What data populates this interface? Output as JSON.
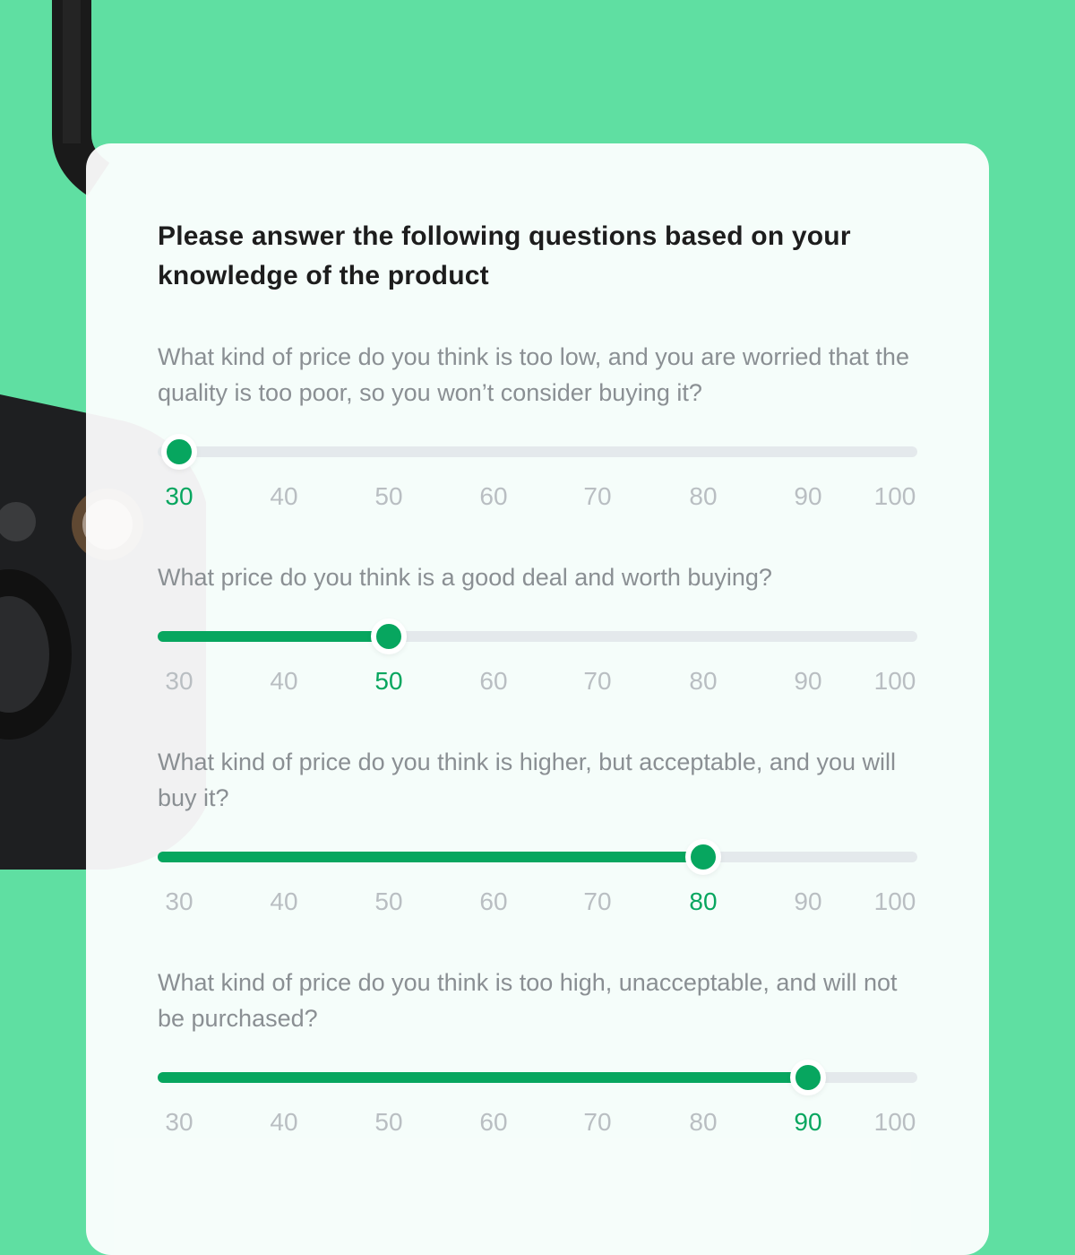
{
  "heading": "Please answer the following questions based on your knowledge of the product",
  "scale": [
    "30",
    "40",
    "50",
    "60",
    "70",
    "80",
    "90",
    "100"
  ],
  "colors": {
    "accent": "#07a65f",
    "track": "#e4e9ec",
    "background": "#5fdfa2"
  },
  "questions": [
    {
      "text": "What kind of price do you think is too low, and you are worried that the quality is too poor, so you won’t consider buying it?",
      "value": 30
    },
    {
      "text": "What price do you think is a good deal and worth buying?",
      "value": 50
    },
    {
      "text": "What kind of price do you think is higher, but acceptable, and you will buy it?",
      "value": 80
    },
    {
      "text": "What kind of price do you think is too high, unacceptable, and will not be purchased?",
      "value": 90
    }
  ]
}
